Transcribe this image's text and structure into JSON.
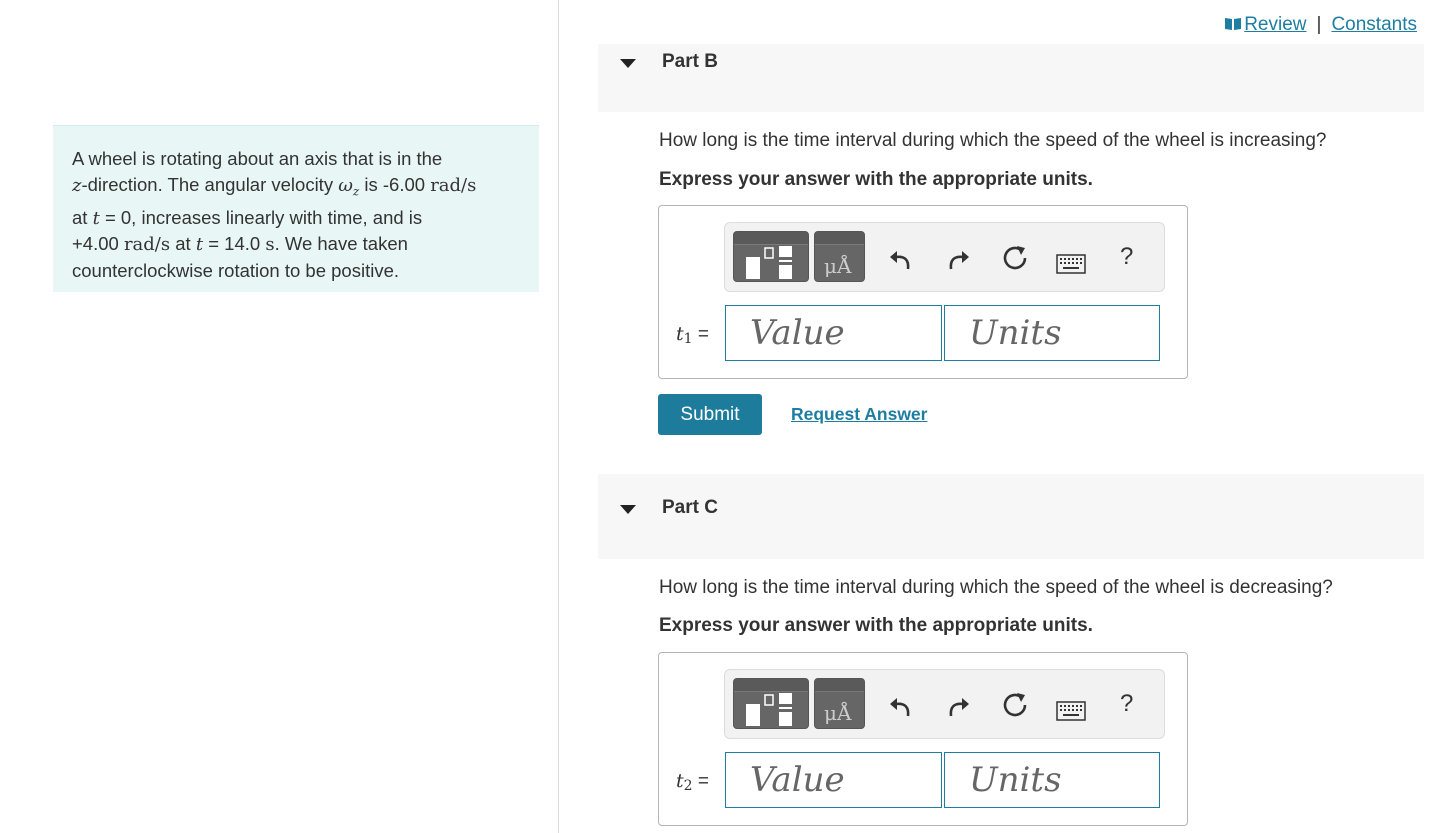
{
  "header": {
    "review_link": "Review",
    "separator": "|",
    "constants_link": "Constants"
  },
  "problem": {
    "text_1": "A wheel is rotating about an axis that is in the",
    "var_z": "z",
    "text_2": "-direction. The angular velocity ",
    "omega": "ω",
    "omega_sub": "z",
    "text_3": " is -6.00 ",
    "unit_rad_s": "rad/s",
    "text_4": "at ",
    "var_t": "t",
    "text_5": " = 0, increases linearly with time, and is",
    "text_6": "+4.00 ",
    "text_7": " at ",
    "text_8": " = 14.0 ",
    "unit_s": "s",
    "text_9": ". We have taken",
    "text_10": "counterclockwise rotation to be positive."
  },
  "parts": [
    {
      "title": "Part B",
      "question": "How long is the time interval during which the speed of the wheel is increasing?",
      "instruction": "Express your answer with the appropriate units.",
      "var": "t",
      "var_sub": "1",
      "equals": "=",
      "value_placeholder": "Value",
      "units_placeholder": "Units",
      "submit_label": "Submit",
      "request_label": "Request Answer"
    },
    {
      "title": "Part C",
      "question": "How long is the time interval during which the speed of the wheel is decreasing?",
      "instruction": "Express your answer with the appropriate units.",
      "var": "t",
      "var_sub": "2",
      "equals": "=",
      "value_placeholder": "Value",
      "units_placeholder": "Units"
    }
  ],
  "toolbar": {
    "units_btn_glyph": "μÅ",
    "help_glyph": "?"
  },
  "colors": {
    "accent": "#1e7ea1",
    "submit_bg": "#1d7c9c",
    "problem_bg": "#e9f6f6",
    "part_header_bg": "#f7f7f7"
  },
  "icons": [
    "book-icon",
    "triangle-down-icon",
    "templates-icon",
    "units-icon",
    "undo-icon",
    "redo-icon",
    "reset-icon",
    "keyboard-icon",
    "help-icon"
  ]
}
